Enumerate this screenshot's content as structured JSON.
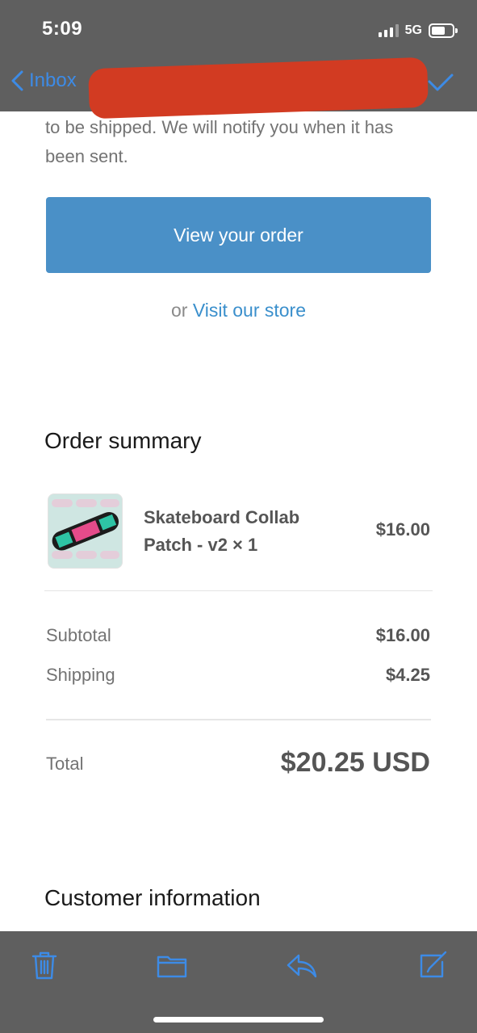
{
  "status_bar": {
    "time": "5:09",
    "network": "5G"
  },
  "nav": {
    "back_label": "Inbox"
  },
  "email": {
    "intro_text": "to be shipped. We will notify you when it has been sent.",
    "cta_label": "View your order",
    "or_text": "or",
    "store_link": "Visit our store"
  },
  "order_summary": {
    "title": "Order summary",
    "item": {
      "name": "Skateboard Collab Patch - v2 × 1",
      "price": "$16.00"
    },
    "subtotal_label": "Subtotal",
    "subtotal_value": "$16.00",
    "shipping_label": "Shipping",
    "shipping_value": "$4.25",
    "total_label": "Total",
    "total_value": "$20.25 USD"
  },
  "customer_info": {
    "title": "Customer information"
  },
  "toolbar": {
    "icons": [
      "trash-icon",
      "folder-icon",
      "reply-icon",
      "compose-icon"
    ],
    "accent": "#3d8be6"
  },
  "colors": {
    "chrome_overlay": "#5f5f5f",
    "button": "#4a90c7",
    "link": "#3a8fcc",
    "redaction": "#d23b22"
  }
}
